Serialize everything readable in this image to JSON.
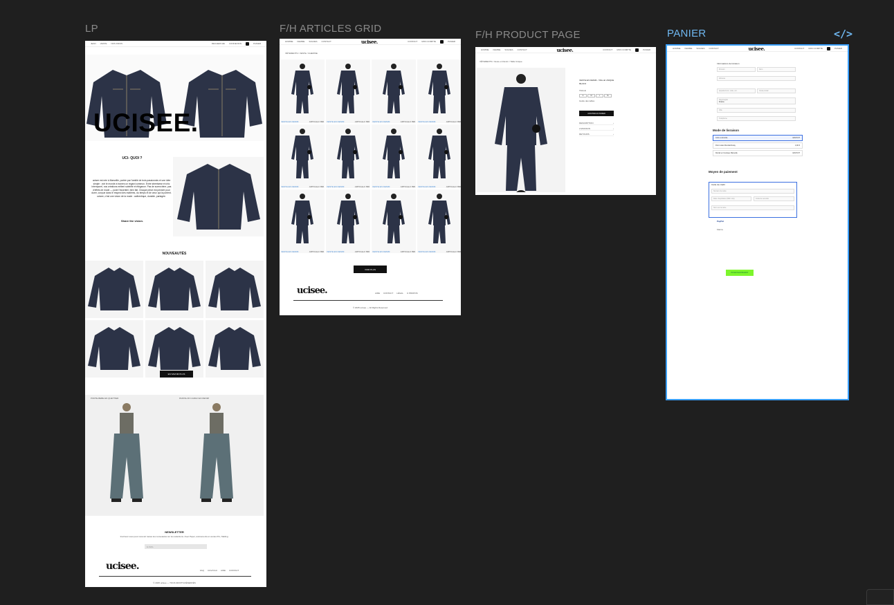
{
  "frames": {
    "lp": {
      "title": "LP",
      "nav_left": [
        "JEAN",
        "VESTE",
        "NOS INFOS"
      ],
      "nav_right": [
        "RECHERCHE",
        "CONNEXION",
        "PANIER"
      ],
      "hero_text": "UCISEE.",
      "about_title": "UCI- QUOI ?",
      "about_text": "ucisee est née à Marseille, portée par l'amitié de trois passionnés et une idée simple : voir le monde à travers un regard commun. Entre streetwear et chic intemporel, nos créations mêlent sobriété et élégance. Pas de surenchère, pas d'effets de mode — juste l'essentiel, bien fait. Chaque pièce est pensée pour durer, conçue dans le respect des matières, du temps et de ceux qui la portent. ucisee, c'est une vision de la mode : authentique, durable, partagée.",
      "about_tagline": "Share the vision.",
      "new_title": "NOUVEAUTÉS",
      "shop_button": "EN SAVOIR PLUS",
      "editorial_left": "PORTE-BEBE EN QUETTIER",
      "editorial_right": "PANTALON CARGO EN DENIM",
      "newsletter_title": "NEWSLETTER",
      "newsletter_text": "Inscrivez-vous pour recevoir toutes les nouveautés sur les sélections. Avec Peper, événements et ventes Pro, Mailing.",
      "newsletter_placeholder": "E-MAIL",
      "footer_logo": "ucisee.",
      "footer_links": [
        "FAQ",
        "CGV/CGU",
        "AIDE",
        "CONTACT"
      ],
      "copyright": "© 2025 ucisee — TOUS DROITS RÉSERVÉS"
    },
    "grid": {
      "title": "F/H ARTICLES GRID",
      "nav_left": [
        "HOMME",
        "FEMME",
        "SOLDES",
        "CONTACT"
      ],
      "nav_right": [
        "CONTACT",
        "MON COMPTE",
        "PANIER"
      ],
      "logo": "ucisee.",
      "breadcrumb": "VÊTEMENTS / VESTE / CHEMISE",
      "caption_left": "VESTE EN DENIM",
      "caption_right": "ARTICLE-F 89€",
      "load_more": "VOIR PLUS",
      "footer_logo": "ucisee.",
      "footer_links": [
        "AIDE",
        "CONTACT",
        "LÉGAL",
        "À PROPOS"
      ],
      "copyright": "© 2025 ucisee — All Rights Reserved"
    },
    "pdp": {
      "title": "F/H PRODUCT PAGE",
      "nav_left": [
        "HOMME",
        "FEMME",
        "SOLDES",
        "CONTACT"
      ],
      "nav_right": [
        "CONTACT",
        "MON COMPTE",
        "PANIER"
      ],
      "logo": "ucisee.",
      "breadcrumb": "VÊTEMENTS / Veste en Denim / Taille Unique",
      "product_name": "VESTE EN DENIM - TAILLE UNIQUE",
      "price": "89,00 €",
      "size_label": "TAILLE",
      "sizes": [
        "S",
        "M",
        "L",
        "XL"
      ],
      "size_guide": "Guide des tailles",
      "add_to_cart": "AJOUTER AU PANIER",
      "accordions": [
        "DESCRIPTION",
        "LIVRAISON",
        "RETOURS"
      ]
    },
    "panier": {
      "title": "PANIER",
      "code_icon": "</>",
      "nav_left": [
        "HOMME",
        "FEMME",
        "SOLDES",
        "CONTACT"
      ],
      "nav_right": [
        "CONTACT",
        "MON COMPTE",
        "PANIER"
      ],
      "logo": "ucisee.",
      "contact_heading": "Informations de livraison",
      "fields": [
        "Prénom",
        "Nom",
        "Adresse",
        "Appartement, suite, etc.",
        "Code postal",
        "Ville",
        "Pays/région",
        "Téléphone"
      ],
      "country_value": "France",
      "shipping_heading": "Mode de livraison",
      "shipping_options": [
        {
          "label": "Colis à domicile",
          "price": "GRATUIT"
        },
        {
          "label": "Point relais Mondial Relay",
          "price": "4,90 €"
        },
        {
          "label": "Retrait en boutique Marseille",
          "price": "GRATUIT"
        }
      ],
      "payment_heading": "Moyen de paiement",
      "card_label": "Carte de crédit",
      "card_number_placeholder": "Numéro de carte",
      "expiry_placeholder": "Date d'expiration (MM / AA)",
      "cvc_placeholder": "Code de sécurité",
      "name_placeholder": "Nom sur la carte",
      "paypal_label": "PayPal",
      "klarna_label": "Klarna",
      "pay_button": "PAYER MAINTENANT"
    }
  }
}
